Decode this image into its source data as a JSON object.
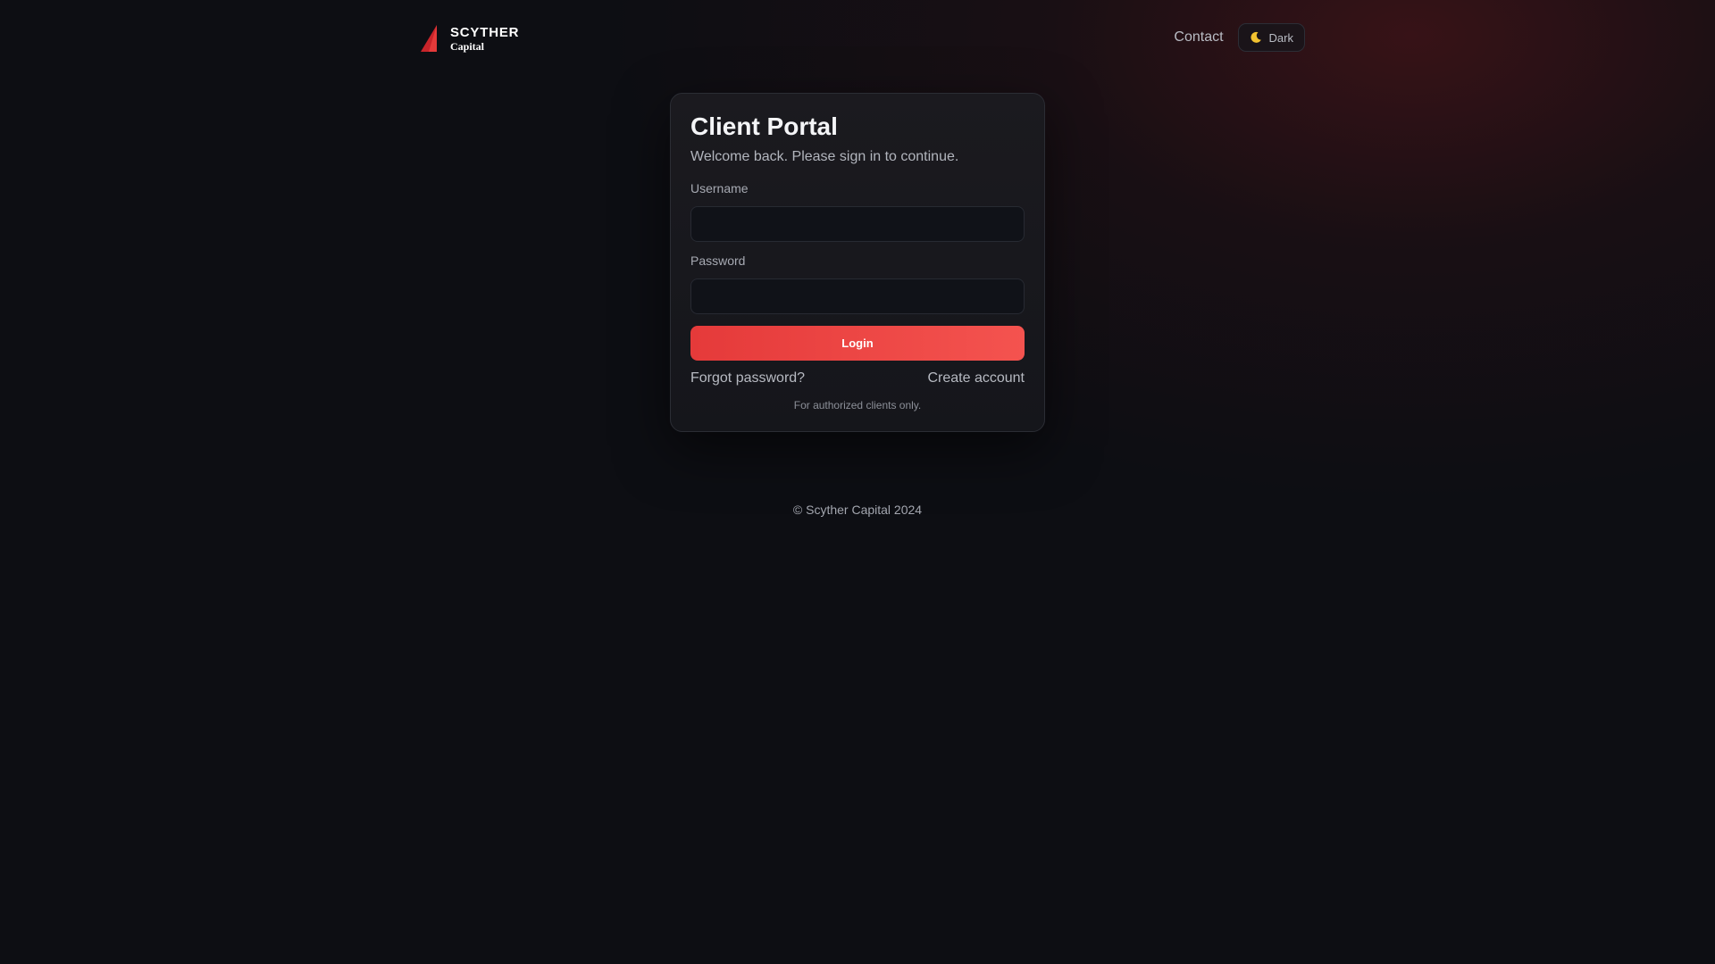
{
  "brand": {
    "name": "SCYTHER",
    "sub": "Capital",
    "logo_icon": "sail-triangle-icon",
    "accent_color": "#e53a3a"
  },
  "nav": {
    "contact_label": "Contact",
    "theme_toggle": {
      "icon": "moon-icon",
      "label": "Dark"
    }
  },
  "login_card": {
    "title": "Client Portal",
    "subtitle": "Welcome back. Please sign in to continue.",
    "username": {
      "label": "Username",
      "value": "",
      "placeholder": ""
    },
    "password": {
      "label": "Password",
      "value": "",
      "placeholder": ""
    },
    "login_button_label": "Login",
    "forgot_password_label": "Forgot password?",
    "create_account_label": "Create account",
    "note": "For authorized clients only."
  },
  "footer": {
    "copyright": "© Scyther Capital 2024"
  },
  "colors": {
    "background": "#0d0e13",
    "card_background": "#18181d",
    "button_gradient_start": "#e53a3a",
    "button_gradient_end": "#f4534f"
  }
}
